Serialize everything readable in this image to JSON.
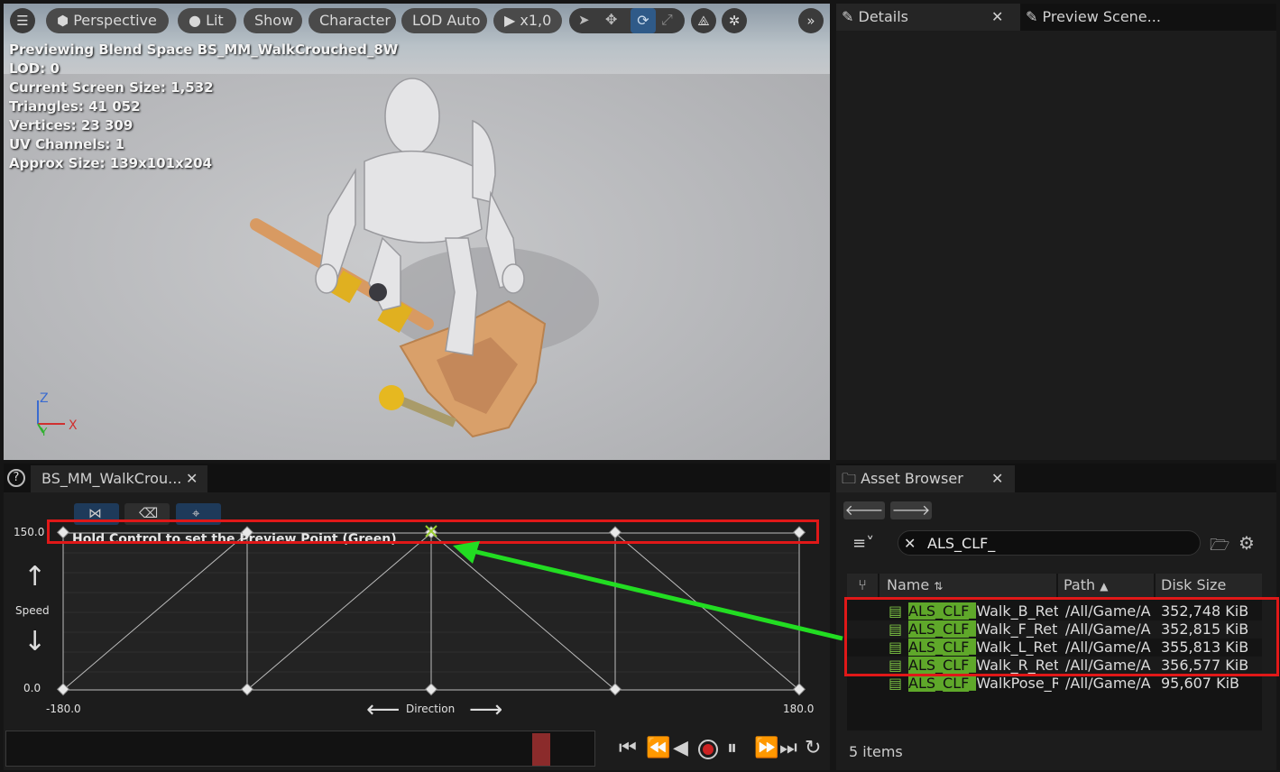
{
  "viewport": {
    "toolbar": {
      "perspective": "Perspective",
      "lit": "Lit",
      "show": "Show",
      "character": "Character",
      "lod": "LOD Auto",
      "speed": "x1,0"
    },
    "stats": {
      "line1": "Previewing Blend Space BS_MM_WalkCrouched_8W",
      "line2": "LOD: 0",
      "line3": "Current Screen Size: 1,532",
      "line4": "Triangles: 41 052",
      "line5": "Vertices: 23 309",
      "line6": "UV Channels: 1",
      "line7": "Approx Size: 139x101x204"
    },
    "axes": {
      "z": "Z",
      "x": "X",
      "y": "Y"
    }
  },
  "details": {
    "tab_details": "Details",
    "tab_preview": "Preview Scene..."
  },
  "blendspace": {
    "tab_title": "BS_MM_WalkCrou...",
    "hint": "Hold Control to set the Preview Point (Green)",
    "y_axis": {
      "label": "Speed",
      "max": "150.0",
      "min": "0.0"
    },
    "x_axis": {
      "label": "Direction",
      "min": "-180.0",
      "max": "180.0"
    }
  },
  "asset_browser": {
    "tab_title": "Asset Browser",
    "search_value": "ALS_CLF_",
    "columns": {
      "name": "Name",
      "path": "Path",
      "disk": "Disk Size"
    },
    "rows": [
      {
        "prefix": "ALS_CLF_",
        "rest": "Walk_B_Reta",
        "path": "/All/Game/A",
        "size": "352,748 KiB"
      },
      {
        "prefix": "ALS_CLF_",
        "rest": "Walk_F_Reta",
        "path": "/All/Game/A",
        "size": "352,815 KiB"
      },
      {
        "prefix": "ALS_CLF_",
        "rest": "Walk_L_Reta",
        "path": "/All/Game/A",
        "size": "355,813 KiB"
      },
      {
        "prefix": "ALS_CLF_",
        "rest": "Walk_R_Reta",
        "path": "/All/Game/A",
        "size": "356,577 KiB"
      },
      {
        "prefix": "ALS_CLF_",
        "rest": "WalkPose_R",
        "path": "/All/Game/A",
        "size": "95,607 KiB"
      }
    ],
    "count": "5 items"
  },
  "colors": {
    "highlight_green": "#5fa82a",
    "annotation_red": "#e01818",
    "annotation_arrow": "#22dd22"
  }
}
